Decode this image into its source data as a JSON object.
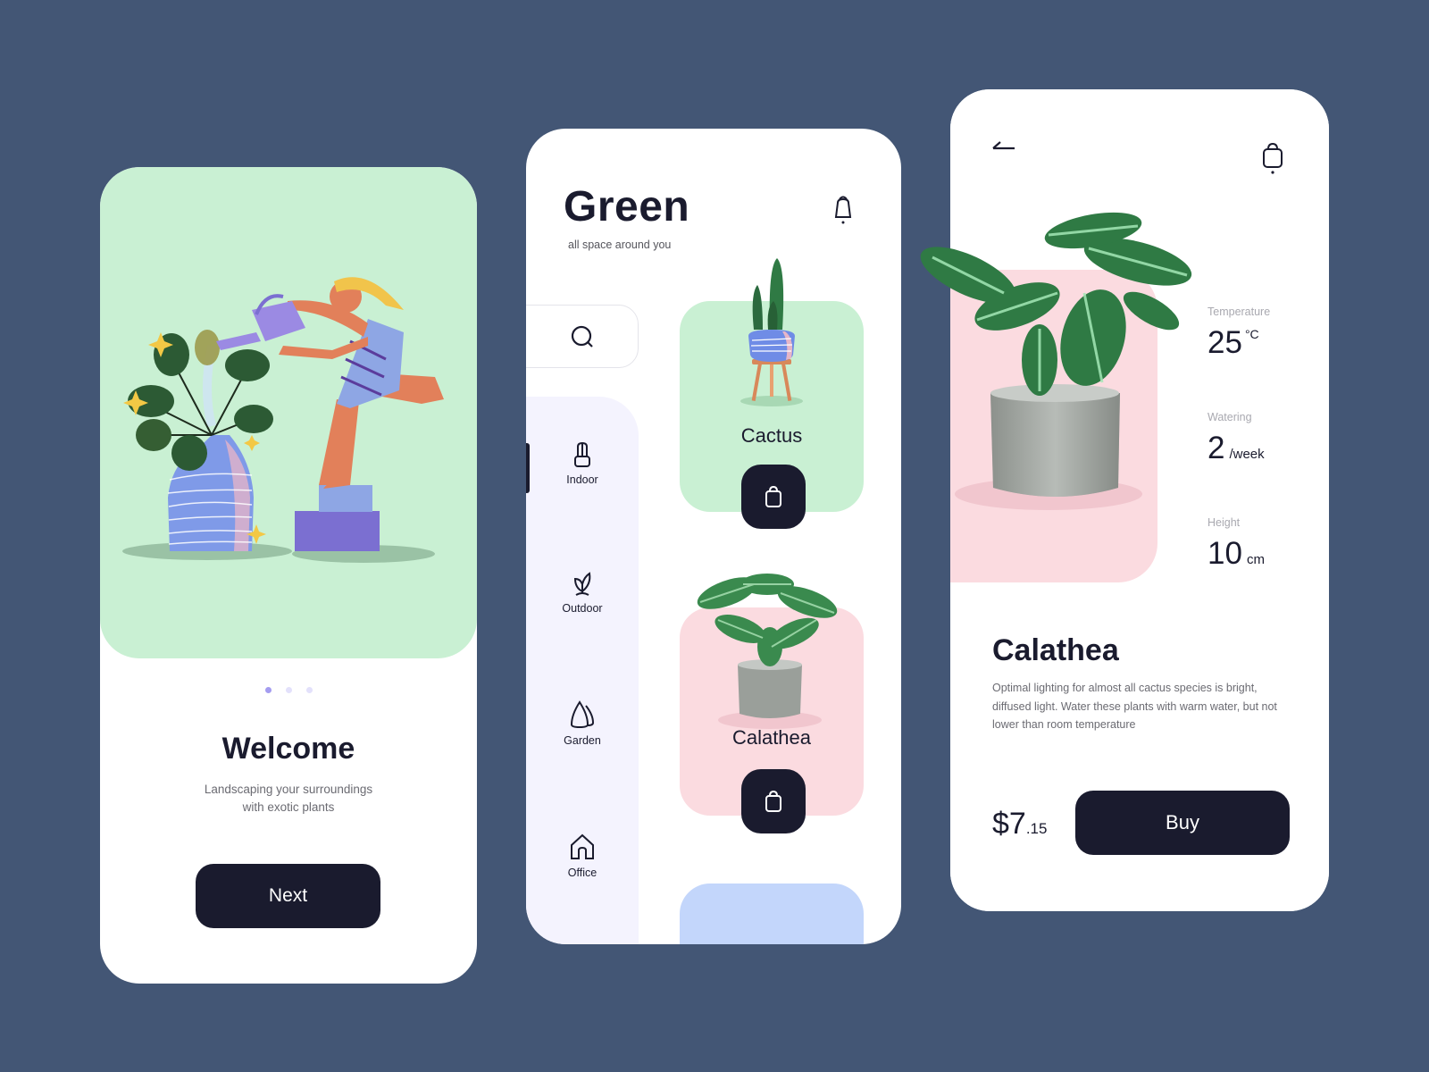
{
  "colors": {
    "background": "#435675",
    "dark": "#1a1b2e",
    "mint": "#c9f0d3",
    "pink": "#fbdbe0",
    "blue": "#c3d6fb",
    "lavender": "#f4f3fe",
    "dot_active": "#a49cf0",
    "dot_inactive": "#e3e1fb"
  },
  "onboarding": {
    "illustration": "woman-watering-plant-illustration",
    "pagination": {
      "total": 3,
      "active": 1
    },
    "title": "Welcome",
    "subtitle_line1": "Landscaping your surroundings",
    "subtitle_line2": "with exotic plants",
    "next_label": "Next"
  },
  "catalog": {
    "brand": "Green",
    "tagline": "all space around you",
    "notification_icon": "bell-icon",
    "search_icon": "search-icon",
    "categories": [
      {
        "label": "Indoor",
        "icon": "potted-cactus-icon",
        "active": true
      },
      {
        "label": "Outdoor",
        "icon": "sprout-icon",
        "active": false
      },
      {
        "label": "Garden",
        "icon": "trees-icon",
        "active": false
      },
      {
        "label": "Office",
        "icon": "house-icon",
        "active": false
      }
    ],
    "products": [
      {
        "name": "Cactus",
        "color": "#c9f0d3",
        "action_icon": "shopping-bag-icon"
      },
      {
        "name": "Calathea",
        "color": "#fbdbe0",
        "action_icon": "shopping-bag-icon"
      },
      {
        "name": "",
        "color": "#c3d6fb"
      }
    ]
  },
  "detail": {
    "back_icon": "arrow-left-icon",
    "bag_icon": "shopping-bag-icon",
    "stats": [
      {
        "label": "Temperature",
        "value": "25",
        "unit": "°C"
      },
      {
        "label": "Watering",
        "value": "2",
        "unit": "/week"
      },
      {
        "label": "Height",
        "value": "10",
        "unit": "cm"
      }
    ],
    "name": "Calathea",
    "description": "Optimal lighting for almost all cactus species is bright, diffused light. Water these plants with warm water, but not lower than room temperature",
    "price_main": "$7",
    "price_cents": ".15",
    "buy_label": "Buy"
  }
}
